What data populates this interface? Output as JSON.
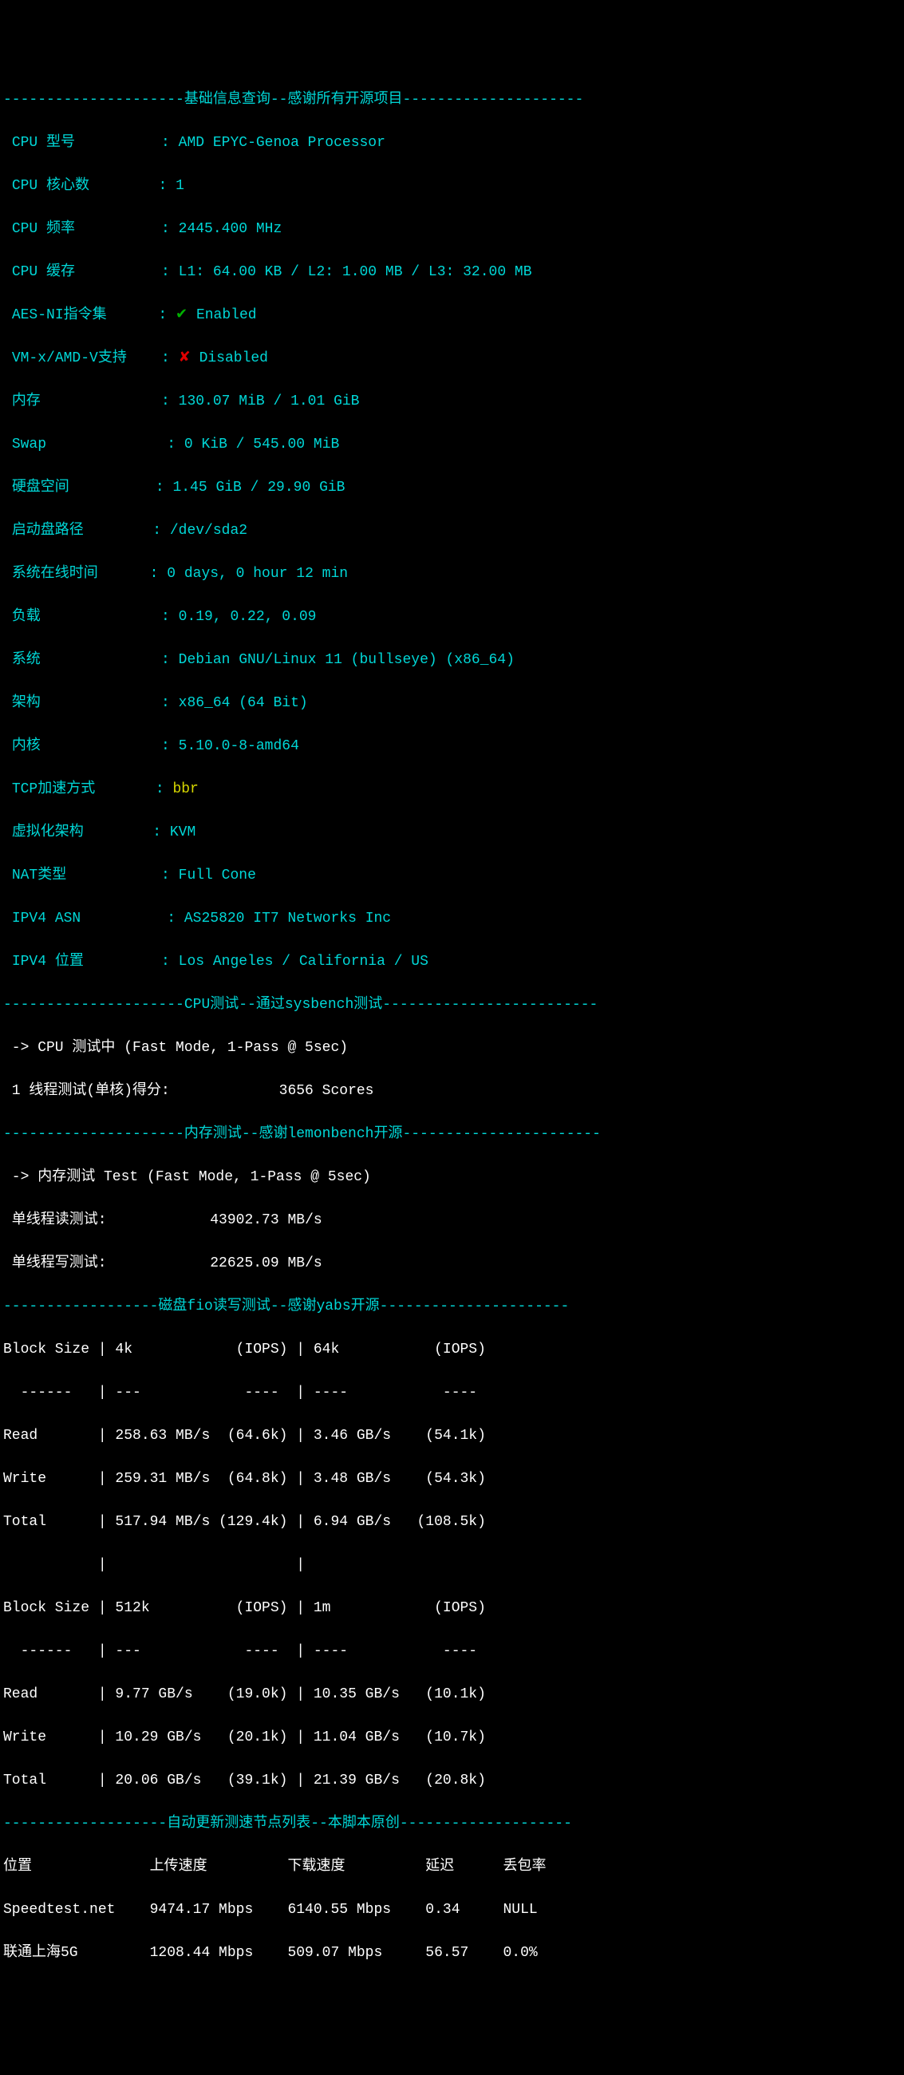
{
  "headers": {
    "basic_info": "---------------------基础信息查询--感谢所有开源项目---------------------",
    "cpu_test": "---------------------CPU测试--通过sysbench测试-------------------------",
    "mem_test": "---------------------内存测试--感谢lemonbench开源-----------------------",
    "disk_test": "------------------磁盘fio读写测试--感谢yabs开源----------------------",
    "speed_test": "-------------------自动更新测速节点列表--本脚本原创--------------------"
  },
  "info": {
    "cpu_model_label": "CPU 型号",
    "cpu_model_value": "AMD EPYC-Genoa Processor",
    "cpu_cores_label": "CPU 核心数",
    "cpu_cores_value": "1",
    "cpu_freq_label": "CPU 频率",
    "cpu_freq_value": "2445.400 MHz",
    "cpu_cache_label": "CPU 缓存",
    "cpu_cache_value": "L1: 64.00 KB / L2: 1.00 MB / L3: 32.00 MB",
    "aes_label": "AES-NI指令集",
    "aes_status": "Enabled",
    "vmx_label": "VM-x/AMD-V支持",
    "vmx_status": "Disabled",
    "memory_label": "内存",
    "memory_value": "130.07 MiB / 1.01 GiB",
    "swap_label": "Swap",
    "swap_value": "0 KiB / 545.00 MiB",
    "disk_label": "硬盘空间",
    "disk_value": "1.45 GiB / 29.90 GiB",
    "bootdisk_label": "启动盘路径",
    "bootdisk_value": "/dev/sda2",
    "uptime_label": "系统在线时间",
    "uptime_value": "0 days, 0 hour 12 min",
    "load_label": "负载",
    "load_value": "0.19, 0.22, 0.09",
    "system_label": "系统",
    "system_value": "Debian GNU/Linux 11 (bullseye) (x86_64)",
    "arch_label": "架构",
    "arch_value": "x86_64 (64 Bit)",
    "kernel_label": "内核",
    "kernel_value": "5.10.0-8-amd64",
    "tcp_label": "TCP加速方式",
    "tcp_value": "bbr",
    "virt_label": "虚拟化架构",
    "virt_value": "KVM",
    "nat_label": "NAT类型",
    "nat_value": "Full Cone",
    "asn_label": "IPV4 ASN",
    "asn_value": "AS25820 IT7 Networks Inc",
    "loc_label": "IPV4 位置",
    "loc_value": "Los Angeles / California / US"
  },
  "cpu": {
    "testing": " -> CPU 测试中 (Fast Mode, 1-Pass @ 5sec)",
    "result": " 1 线程测试(单核)得分: \t\t3656 Scores"
  },
  "mem": {
    "testing": " -> 内存测试 Test (Fast Mode, 1-Pass @ 5sec)",
    "read": " 单线程读测试:\t\t43902.73 MB/s",
    "write": " 单线程写测试:\t\t22625.09 MB/s"
  },
  "fio": {
    "hdr1": "Block Size | 4k            (IOPS) | 64k           (IOPS)",
    "dash1": "  ------   | ---            ----  | ----           ---- ",
    "r1": "Read       | 258.63 MB/s  (64.6k) | 3.46 GB/s    (54.1k)",
    "w1": "Write      | 259.31 MB/s  (64.8k) | 3.48 GB/s    (54.3k)",
    "t1": "Total      | 517.94 MB/s (129.4k) | 6.94 GB/s   (108.5k)",
    "blank": "           |                      |                     ",
    "hdr2": "Block Size | 512k          (IOPS) | 1m            (IOPS)",
    "dash2": "  ------   | ---            ----  | ----           ---- ",
    "r2": "Read       | 9.77 GB/s    (19.0k) | 10.35 GB/s   (10.1k)",
    "w2": "Write      | 10.29 GB/s   (20.1k) | 11.04 GB/s   (10.7k)",
    "t2": "Total      | 20.06 GB/s   (39.1k) | 21.39 GB/s   (20.8k)"
  },
  "speed": {
    "hdr": "位置\t\t 上传速度\t 下载速度\t 延迟\t  丢包率",
    "row1": "Speedtest.net\t 9474.17 Mbps\t 6140.55 Mbps\t 0.34\t  NULL",
    "row2": "联通上海5G\t 1208.44 Mbps\t 509.07 Mbps\t 56.57\t  0.0%"
  },
  "check": "✔",
  "cross": "✘"
}
